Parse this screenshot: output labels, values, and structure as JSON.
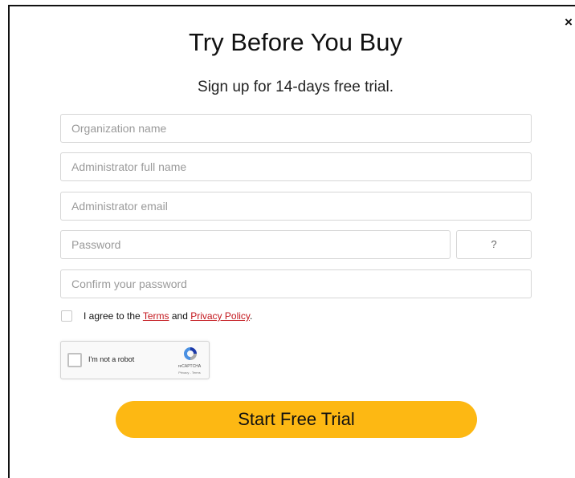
{
  "modal": {
    "close_label": "×",
    "title": "Try Before You Buy",
    "subtitle": "Sign up for 14-days free trial."
  },
  "form": {
    "organization_placeholder": "Organization name",
    "admin_name_placeholder": "Administrator full name",
    "admin_email_placeholder": "Administrator email",
    "password_placeholder": "Password",
    "password_hint_label": "?",
    "confirm_password_placeholder": "Confirm your password",
    "agree_prefix": "I agree to the ",
    "terms_link": "Terms",
    "agree_and": " and ",
    "privacy_link": "Privacy Policy",
    "agree_suffix": "."
  },
  "captcha": {
    "label": "I'm not a robot",
    "brand": "reCAPTCHA",
    "links": "Privacy - Terms"
  },
  "cta": {
    "label": "Start Free Trial"
  },
  "colors": {
    "accent": "#fdb813",
    "link": "#c3161c"
  }
}
